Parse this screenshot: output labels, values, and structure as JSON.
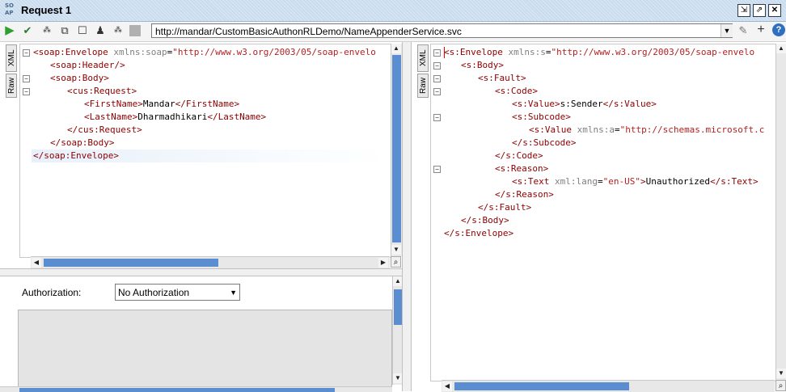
{
  "window": {
    "title": "Request 1",
    "logo": "SO AP"
  },
  "toolbar": {
    "url": "http://mandar/CustomBasicAuthonRLDemo/NameAppenderService.svc",
    "icons": [
      "run-icon",
      "submit-check-icon",
      "cancel-icon",
      "fullscreen-icon",
      "stop-icon",
      "user-icon",
      "auth-icon",
      "square-icon"
    ]
  },
  "request": {
    "tabs": {
      "xml": "XML",
      "raw": "Raw"
    },
    "lines": [
      {
        "indent": 0,
        "parts": [
          [
            "t",
            "<soap:Envelope "
          ],
          [
            "a",
            "xmlns:soap"
          ],
          [
            "x",
            "="
          ],
          [
            "v",
            "\"http://www.w3.org/2003/05/soap-envelo"
          ]
        ]
      },
      {
        "indent": 1,
        "parts": [
          [
            "t",
            "<soap:Header/>"
          ]
        ]
      },
      {
        "indent": 1,
        "parts": [
          [
            "t",
            "<soap:Body>"
          ]
        ]
      },
      {
        "indent": 2,
        "parts": [
          [
            "t",
            "<cus:Request>"
          ]
        ]
      },
      {
        "indent": 3,
        "parts": [
          [
            "t",
            "<FirstName>"
          ],
          [
            "x",
            "Mandar"
          ],
          [
            "t",
            "</FirstName>"
          ]
        ]
      },
      {
        "indent": 3,
        "parts": [
          [
            "t",
            "<LastName>"
          ],
          [
            "x",
            "Dharmadhikari"
          ],
          [
            "t",
            "</LastName>"
          ]
        ]
      },
      {
        "indent": 2,
        "parts": [
          [
            "t",
            "</cus:Request>"
          ]
        ]
      },
      {
        "indent": 1,
        "parts": [
          [
            "t",
            "</soap:Body>"
          ]
        ]
      },
      {
        "indent": 0,
        "parts": [
          [
            "t",
            "</soap:Envelope>"
          ]
        ]
      }
    ]
  },
  "response": {
    "tabs": {
      "xml": "XML",
      "raw": "Raw"
    },
    "lines": [
      {
        "indent": 0,
        "parts": [
          [
            "t",
            "<s:Envelope "
          ],
          [
            "a",
            "xmlns:s"
          ],
          [
            "x",
            "="
          ],
          [
            "v",
            "\"http://www.w3.org/2003/05/soap-envelo"
          ]
        ]
      },
      {
        "indent": 1,
        "parts": [
          [
            "t",
            "<s:Body>"
          ]
        ]
      },
      {
        "indent": 2,
        "parts": [
          [
            "t",
            "<s:Fault>"
          ]
        ]
      },
      {
        "indent": 3,
        "parts": [
          [
            "t",
            "<s:Code>"
          ]
        ]
      },
      {
        "indent": 4,
        "parts": [
          [
            "t",
            "<s:Value>"
          ],
          [
            "x",
            "s:Sender"
          ],
          [
            "t",
            "</s:Value>"
          ]
        ]
      },
      {
        "indent": 4,
        "parts": [
          [
            "t",
            "<s:Subcode>"
          ]
        ]
      },
      {
        "indent": 5,
        "parts": [
          [
            "t",
            "<s:Value "
          ],
          [
            "a",
            "xmlns:a"
          ],
          [
            "x",
            "="
          ],
          [
            "v",
            "\"http://schemas.microsoft.c"
          ]
        ]
      },
      {
        "indent": 4,
        "parts": [
          [
            "t",
            "</s:Subcode>"
          ]
        ]
      },
      {
        "indent": 3,
        "parts": [
          [
            "t",
            "</s:Code>"
          ]
        ]
      },
      {
        "indent": 3,
        "parts": [
          [
            "t",
            "<s:Reason>"
          ]
        ]
      },
      {
        "indent": 4,
        "parts": [
          [
            "t",
            "<s:Text "
          ],
          [
            "a",
            "xml:lang"
          ],
          [
            "x",
            "="
          ],
          [
            "v",
            "\"en-US\""
          ],
          [
            "t",
            ">"
          ],
          [
            "x",
            "Unauthorized"
          ],
          [
            "t",
            "</s:Text>"
          ]
        ]
      },
      {
        "indent": 3,
        "parts": [
          [
            "t",
            "</s:Reason>"
          ]
        ]
      },
      {
        "indent": 2,
        "parts": [
          [
            "t",
            "</s:Fault>"
          ]
        ]
      },
      {
        "indent": 1,
        "parts": [
          [
            "t",
            "</s:Body>"
          ]
        ]
      },
      {
        "indent": 0,
        "parts": [
          [
            "t",
            "</s:Envelope>"
          ]
        ]
      }
    ]
  },
  "auth": {
    "label": "Authorization:",
    "selected": "No Authorization"
  }
}
